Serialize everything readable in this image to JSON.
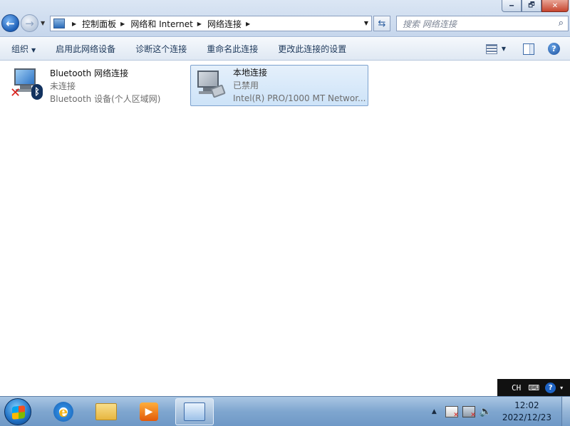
{
  "window": {
    "minimize": "🗕",
    "maximize": "🗗",
    "close": "✕"
  },
  "address": {
    "crumbs": [
      "控制面板",
      "网络和 Internet",
      "网络连接"
    ]
  },
  "search": {
    "placeholder": "搜索 网络连接"
  },
  "toolbar": {
    "organize": "组织",
    "enable": "启用此网络设备",
    "diagnose": "诊断这个连接",
    "rename": "重命名此连接",
    "change_settings": "更改此连接的设置"
  },
  "connections": [
    {
      "name": "Bluetooth 网络连接",
      "status": "未连接",
      "device": "Bluetooth 设备(个人区域网)"
    },
    {
      "name": "本地连接",
      "status": "已禁用",
      "device": "Intel(R) PRO/1000 MT Networ..."
    }
  ],
  "language_bar": {
    "lang": "CH"
  },
  "clock": {
    "time": "12:02",
    "date": "2022/12/23"
  }
}
